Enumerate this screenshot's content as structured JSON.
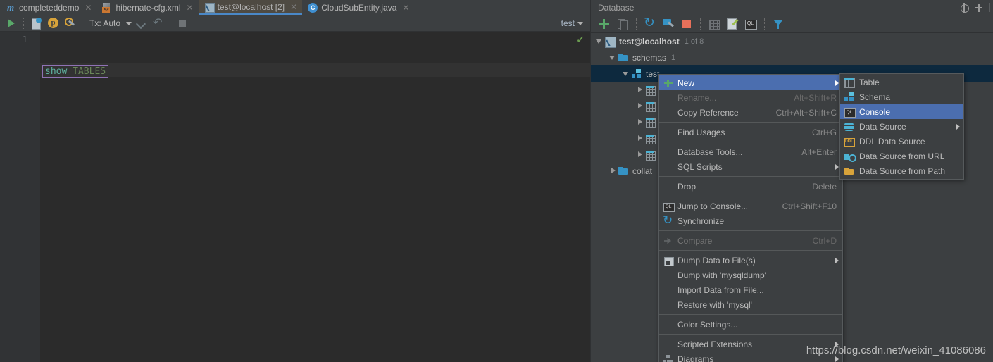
{
  "editor": {
    "tabs": [
      {
        "label": "completeddemo",
        "icon": "module-icon",
        "active": false,
        "closable": true
      },
      {
        "label": "hibernate-cfg.xml",
        "icon": "xml-file-icon",
        "active": false,
        "closable": true
      },
      {
        "label": "test@localhost [2]",
        "icon": "database-console-icon",
        "active": true,
        "closable": true
      },
      {
        "label": "CloudSubEntity.java",
        "icon": "java-class-icon",
        "active": false,
        "closable": true
      }
    ],
    "toolbar": {
      "run_label": "Run",
      "script_label": "Execute Script",
      "parameters_label": "Parameters",
      "settings_label": "Data Source Properties",
      "tx_label": "Tx: Auto",
      "commit_label": "Commit",
      "rollback_label": "Rollback",
      "stop_label": "Stop",
      "schema_label": "test"
    },
    "code": {
      "line_number": "1",
      "keyword": "show",
      "rest": " TABLES",
      "full_text": "show TABLES",
      "inspection_mark": "✓"
    }
  },
  "database_panel": {
    "title": "Database",
    "header_icons": [
      "settings-icon",
      "hide-icon"
    ],
    "toolbar_icons": [
      "add-icon",
      "duplicate-icon",
      "synchronize-icon",
      "data-source-properties-icon",
      "stop-icon",
      "table-editor-icon",
      "modify-table-icon",
      "jump-to-console-icon",
      "filter-icon"
    ],
    "tree": [
      {
        "label": "test@localhost",
        "badge": "1 of 8",
        "icon": "database-console-icon",
        "indent": 0,
        "expander": "expanded",
        "bold": true,
        "selected": false
      },
      {
        "label": "schemas",
        "badge": "1",
        "icon": "folder-icon",
        "indent": 1,
        "expander": "expanded",
        "bold": false,
        "selected": false
      },
      {
        "label": "test",
        "badge": "",
        "icon": "schema-icon",
        "indent": 2,
        "expander": "expanded",
        "bold": false,
        "selected": true
      },
      {
        "label": "",
        "badge": "",
        "icon": "table-icon",
        "indent": 3,
        "expander": "collapsed",
        "bold": false,
        "selected": false
      },
      {
        "label": "",
        "badge": "",
        "icon": "table-icon",
        "indent": 3,
        "expander": "collapsed",
        "bold": false,
        "selected": false
      },
      {
        "label": "",
        "badge": "",
        "icon": "table-icon",
        "indent": 3,
        "expander": "collapsed",
        "bold": false,
        "selected": false
      },
      {
        "label": "",
        "badge": "",
        "icon": "table-icon",
        "indent": 3,
        "expander": "collapsed",
        "bold": false,
        "selected": false
      },
      {
        "label": "",
        "badge": "",
        "icon": "table-icon",
        "indent": 3,
        "expander": "collapsed",
        "bold": false,
        "selected": false
      },
      {
        "label": "collat",
        "badge": "",
        "icon": "folder-icon",
        "indent": 1,
        "expander": "collapsed",
        "bold": false,
        "selected": false
      }
    ]
  },
  "context_menu": {
    "items": [
      {
        "type": "item",
        "label": "New",
        "accel": "",
        "icon": "plus-icon",
        "arrow": true,
        "highlight": true,
        "disabled": false
      },
      {
        "type": "item",
        "label": "Rename...",
        "accel": "Alt+Shift+R",
        "icon": "",
        "arrow": false,
        "highlight": false,
        "disabled": true
      },
      {
        "type": "item",
        "label": "Copy Reference",
        "accel": "Ctrl+Alt+Shift+C",
        "icon": "",
        "arrow": false,
        "highlight": false,
        "disabled": false
      },
      {
        "type": "sep"
      },
      {
        "type": "item",
        "label": "Find Usages",
        "accel": "Ctrl+G",
        "icon": "",
        "arrow": false,
        "highlight": false,
        "disabled": false
      },
      {
        "type": "sep"
      },
      {
        "type": "item",
        "label": "Database Tools...",
        "accel": "Alt+Enter",
        "icon": "",
        "arrow": false,
        "highlight": false,
        "disabled": false
      },
      {
        "type": "item",
        "label": "SQL Scripts",
        "accel": "",
        "icon": "",
        "arrow": true,
        "highlight": false,
        "disabled": false
      },
      {
        "type": "sep"
      },
      {
        "type": "item",
        "label": "Drop",
        "accel": "Delete",
        "icon": "",
        "arrow": false,
        "highlight": false,
        "disabled": false
      },
      {
        "type": "sep"
      },
      {
        "type": "item",
        "label": "Jump to Console...",
        "accel": "Ctrl+Shift+F10",
        "icon": "sql-console-icon",
        "arrow": false,
        "highlight": false,
        "disabled": false
      },
      {
        "type": "item",
        "label": "Synchronize",
        "accel": "",
        "icon": "synchronize-icon",
        "arrow": false,
        "highlight": false,
        "disabled": false
      },
      {
        "type": "sep"
      },
      {
        "type": "item",
        "label": "Compare",
        "accel": "Ctrl+D",
        "icon": "compare-icon",
        "arrow": false,
        "highlight": false,
        "disabled": true
      },
      {
        "type": "sep"
      },
      {
        "type": "item",
        "label": "Dump Data to File(s)",
        "accel": "",
        "icon": "save-icon",
        "arrow": true,
        "highlight": false,
        "disabled": false
      },
      {
        "type": "item",
        "label": "Dump with 'mysqldump'",
        "accel": "",
        "icon": "",
        "arrow": false,
        "highlight": false,
        "disabled": false
      },
      {
        "type": "item",
        "label": "Import Data from File...",
        "accel": "",
        "icon": "",
        "arrow": false,
        "highlight": false,
        "disabled": false
      },
      {
        "type": "item",
        "label": "Restore with 'mysql'",
        "accel": "",
        "icon": "",
        "arrow": false,
        "highlight": false,
        "disabled": false
      },
      {
        "type": "sep"
      },
      {
        "type": "item",
        "label": "Color Settings...",
        "accel": "",
        "icon": "",
        "arrow": false,
        "highlight": false,
        "disabled": false
      },
      {
        "type": "sep"
      },
      {
        "type": "item",
        "label": "Scripted Extensions",
        "accel": "",
        "icon": "",
        "arrow": true,
        "highlight": false,
        "disabled": false
      },
      {
        "type": "item",
        "label": "Diagrams",
        "accel": "",
        "icon": "diagram-icon",
        "arrow": true,
        "highlight": false,
        "disabled": false
      }
    ]
  },
  "sub_menu": {
    "items": [
      {
        "label": "Table",
        "icon": "table-icon",
        "arrow": false,
        "highlight": false
      },
      {
        "label": "Schema",
        "icon": "schema-icon",
        "arrow": false,
        "highlight": false
      },
      {
        "label": "Console",
        "icon": "sql-console-icon",
        "arrow": false,
        "highlight": true
      },
      {
        "label": "Data Source",
        "icon": "data-source-icon",
        "arrow": true,
        "highlight": false
      },
      {
        "label": "DDL Data Source",
        "icon": "ddl-data-source-icon",
        "arrow": false,
        "highlight": false
      },
      {
        "label": "Data Source from URL",
        "icon": "url-icon",
        "arrow": false,
        "highlight": false
      },
      {
        "label": "Data Source from Path",
        "icon": "folder-open-icon",
        "arrow": false,
        "highlight": false
      }
    ]
  },
  "watermark": {
    "text": "https://blog.csdn.net/weixin_41086086"
  },
  "colors": {
    "background": "#3c3f41",
    "editor_background": "#2b2b2b",
    "menu_highlight": "#4b6eaf",
    "tree_selected": "#0d293e",
    "accent_green": "#59a869",
    "accent_blue": "#3592c4",
    "sql_keyword": "#6a8759"
  }
}
